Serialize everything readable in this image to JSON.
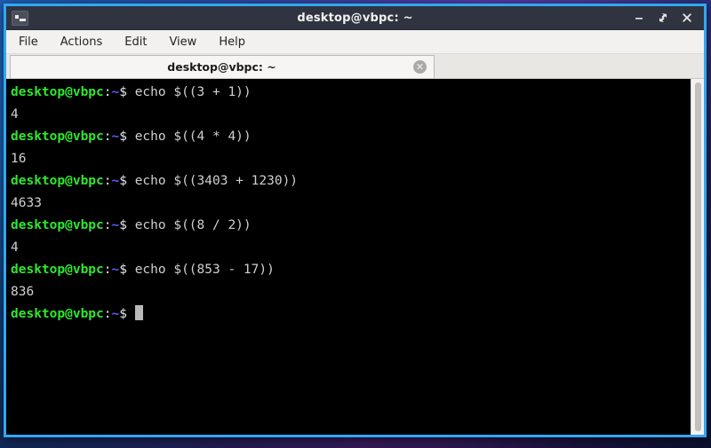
{
  "window": {
    "title": "desktop@vbpc: ~",
    "app_icon": "terminal-icon",
    "controls": {
      "minimize": "minimize-icon",
      "maximize": "maximize-icon",
      "close": "close-icon"
    }
  },
  "menubar": {
    "items": [
      {
        "label": "File"
      },
      {
        "label": "Actions"
      },
      {
        "label": "Edit"
      },
      {
        "label": "View"
      },
      {
        "label": "Help"
      }
    ]
  },
  "tabs": [
    {
      "label": "desktop@vbpc: ~",
      "close_icon": "close-circle-icon",
      "active": true
    }
  ],
  "terminal": {
    "prompt": {
      "user_host": "desktop@vbpc",
      "colon": ":",
      "path": "~",
      "symbol": "$"
    },
    "colors": {
      "background": "#000000",
      "user_host": "#2ee82e",
      "path": "#5c5cf0",
      "text": "#d0d0d0",
      "cursor": "#b9b9b9"
    },
    "lines": [
      {
        "type": "command",
        "text": " echo $((3 + 1))"
      },
      {
        "type": "output",
        "text": "4"
      },
      {
        "type": "command",
        "text": " echo $((4 * 4))"
      },
      {
        "type": "output",
        "text": "16"
      },
      {
        "type": "command",
        "text": " echo $((3403 + 1230))"
      },
      {
        "type": "output",
        "text": "4633"
      },
      {
        "type": "command",
        "text": " echo $((8 / 2))"
      },
      {
        "type": "output",
        "text": "4"
      },
      {
        "type": "command",
        "text": " echo $((853 - 17))"
      },
      {
        "type": "output",
        "text": "836"
      },
      {
        "type": "prompt_only",
        "text": " "
      }
    ]
  },
  "scrollbar": {
    "name": "terminal-scrollbar"
  }
}
